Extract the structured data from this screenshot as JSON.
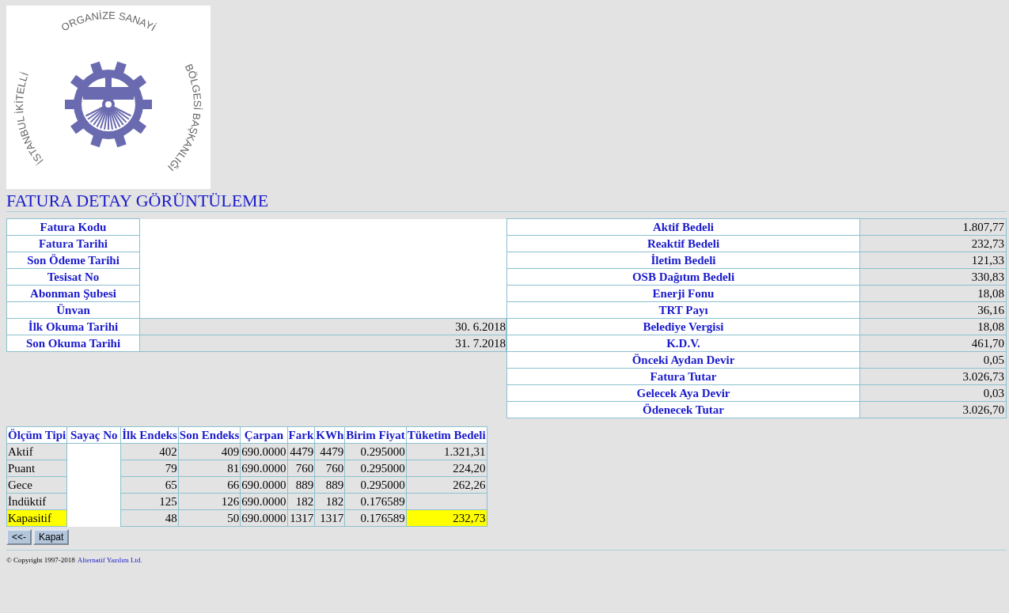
{
  "logo": {
    "text_segments": [
      "İSTANBUL İKİTELLİ",
      "ORGANİZE SANAYİ",
      "BÖLGESİ BAŞKANLIĞI"
    ]
  },
  "title": "FATURA DETAY GÖRÜNTÜLEME",
  "info": [
    {
      "label": "Fatura Kodu",
      "redacted": true
    },
    {
      "label": "Fatura Tarihi",
      "redacted": true
    },
    {
      "label": "Son Ödeme Tarihi",
      "redacted": true
    },
    {
      "label": "Tesisat No",
      "redacted": true
    },
    {
      "label": "Abonman Şubesi",
      "redacted": true
    },
    {
      "label": "Ünvan",
      "redacted": true
    },
    {
      "label": "İlk Okuma Tarihi",
      "redacted": false,
      "value": "30. 6.2018"
    },
    {
      "label": "Son Okuma Tarihi",
      "redacted": false,
      "value": "31. 7.2018"
    }
  ],
  "charges": [
    {
      "label": "Aktif Bedeli",
      "value": "1.807,77"
    },
    {
      "label": "Reaktif Bedeli",
      "value": "232,73"
    },
    {
      "label": "İletim Bedeli",
      "value": "121,33"
    },
    {
      "label": "OSB Dağıtım Bedeli",
      "value": "330,83"
    },
    {
      "label": "Enerji Fonu",
      "value": "18,08"
    },
    {
      "label": "TRT Payı",
      "value": "36,16"
    },
    {
      "label": "Belediye Vergisi",
      "value": "18,08"
    },
    {
      "label": "K.D.V.",
      "value": "461,70"
    },
    {
      "label": "Önceki Aydan Devir",
      "value": "0,05"
    },
    {
      "label": "Fatura Tutar",
      "value": "3.026,73"
    },
    {
      "label": "Gelecek Aya Devir",
      "value": "0,03"
    },
    {
      "label": "Ödenecek Tutar",
      "value": "3.026,70"
    }
  ],
  "meters": {
    "columns": [
      {
        "label": "Ölçüm Tipi",
        "redacted": false
      },
      {
        "label": "Sayaç No",
        "redacted": true
      },
      {
        "label": "İlk Endeks",
        "redacted": false
      },
      {
        "label": "Son Endeks",
        "redacted": false
      },
      {
        "label": "Çarpan",
        "redacted": false
      },
      {
        "label": "Fark",
        "redacted": false
      },
      {
        "label": "KWh",
        "redacted": false
      },
      {
        "label": "Birim Fiyat",
        "redacted": false
      },
      {
        "label": "Tüketim Bedeli",
        "redacted": false
      }
    ],
    "rows": [
      {
        "highlighted": false,
        "cells": [
          "Aktif",
          "",
          "402",
          "409",
          "690.0000",
          "4479",
          "4479",
          "0.295000",
          "1.321,31"
        ]
      },
      {
        "highlighted": false,
        "cells": [
          "Puant",
          "",
          "79",
          "81",
          "690.0000",
          "760",
          "760",
          "0.295000",
          "224,20"
        ]
      },
      {
        "highlighted": false,
        "cells": [
          "Gece",
          "",
          "65",
          "66",
          "690.0000",
          "889",
          "889",
          "0.295000",
          "262,26"
        ]
      },
      {
        "highlighted": false,
        "cells": [
          "İndüktif",
          "",
          "125",
          "126",
          "690.0000",
          "182",
          "182",
          "0.176589",
          ""
        ]
      },
      {
        "highlighted": true,
        "cells": [
          "Kapasitif",
          "",
          "48",
          "50",
          "690.0000",
          "1317",
          "1317",
          "0.176589",
          "232,73"
        ]
      }
    ]
  },
  "buttons": [
    "<<-",
    "Kapat"
  ],
  "footer": {
    "copyright": "© Copyright 1997-2018",
    "link": "Alternatif Yazılım Ltd."
  }
}
